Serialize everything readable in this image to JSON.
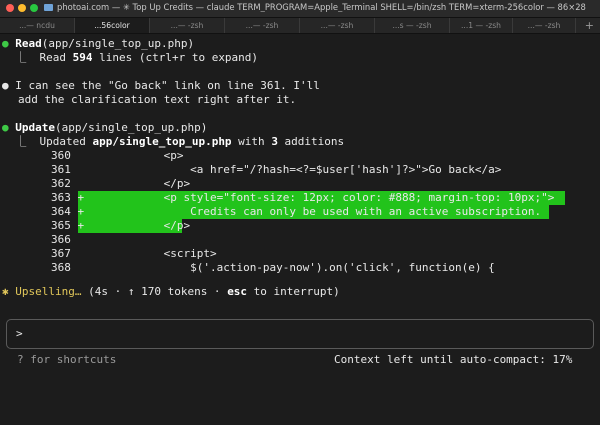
{
  "window": {
    "title": "photoai.com — ✳ Top Up Credits — claude TERM_PROGRAM=Apple_Terminal SHELL=/bin/zsh TERM=xterm-256color — 86×28"
  },
  "tabs": [
    {
      "label": "...— ncdu"
    },
    {
      "label": "...56color"
    },
    {
      "label": "...— -zsh"
    },
    {
      "label": "...— -zsh"
    },
    {
      "label": "...— -zsh"
    },
    {
      "label": "...s — -zsh"
    },
    {
      "label": "...1 — -zsh"
    },
    {
      "label": "...— -zsh"
    }
  ],
  "terminal": {
    "read": {
      "bullet": "●",
      "tool": "Read",
      "args": "(app/single_top_up.php)",
      "result_prefix": "  ⎿  Read ",
      "result_count": "594",
      "result_suffix": " lines (ctrl+r to expand)"
    },
    "message": {
      "bullet": "●",
      "line1": "I can see the \"Go back\" link on line 361. I'll",
      "line2": "add the clarification text right after it."
    },
    "update": {
      "bullet": "●",
      "tool": "Update",
      "args": "(app/single_top_up.php)",
      "summary_prefix": "  ⎿  Updated ",
      "summary_file": "app/single_top_up.php",
      "summary_mid": " with ",
      "summary_count": "3",
      "summary_suffix": " additions"
    },
    "diff": [
      {
        "num": "360",
        "marker": " ",
        "code": "            <p>",
        "added": false
      },
      {
        "num": "361",
        "marker": " ",
        "code": "                <a href=\"/?hash=<?=$user['hash']?>\">Go back</a>",
        "added": false
      },
      {
        "num": "362",
        "marker": " ",
        "code": "            </p>",
        "added": false
      },
      {
        "num": "363",
        "marker": "+",
        "code": "            <p style=\"font-size: 12px; color: #888; margin-top: 10px;\">",
        "added": true
      },
      {
        "num": "364",
        "marker": "+",
        "code": "                Credits can only be used with an active subscription.",
        "added": true
      },
      {
        "num": "365",
        "marker": "+",
        "code": "            </p>",
        "added": true
      },
      {
        "num": "366",
        "marker": " ",
        "code": "",
        "added": false
      },
      {
        "num": "367",
        "marker": " ",
        "code": "            <script>",
        "added": false
      },
      {
        "num": "368",
        "marker": " ",
        "code": "                $('.action-pay-now').on('click', function(e) {",
        "added": false
      }
    ],
    "status": {
      "spinner": "✱",
      "label": "Upselling…",
      "detail_prefix": " (4s · ↑ 170 tokens · ",
      "key": "esc",
      "detail_suffix": " to interrupt)"
    },
    "prompt": {
      "symbol": ">"
    },
    "footer": {
      "left": "? for shortcuts",
      "right": "Context left until auto-compact: 17%"
    }
  },
  "colors": {
    "background": "#1c1c1c",
    "success_bullet": "#3ec946",
    "diff_added_bg": "#22c31b",
    "status_yellow": "#e0c65a"
  }
}
